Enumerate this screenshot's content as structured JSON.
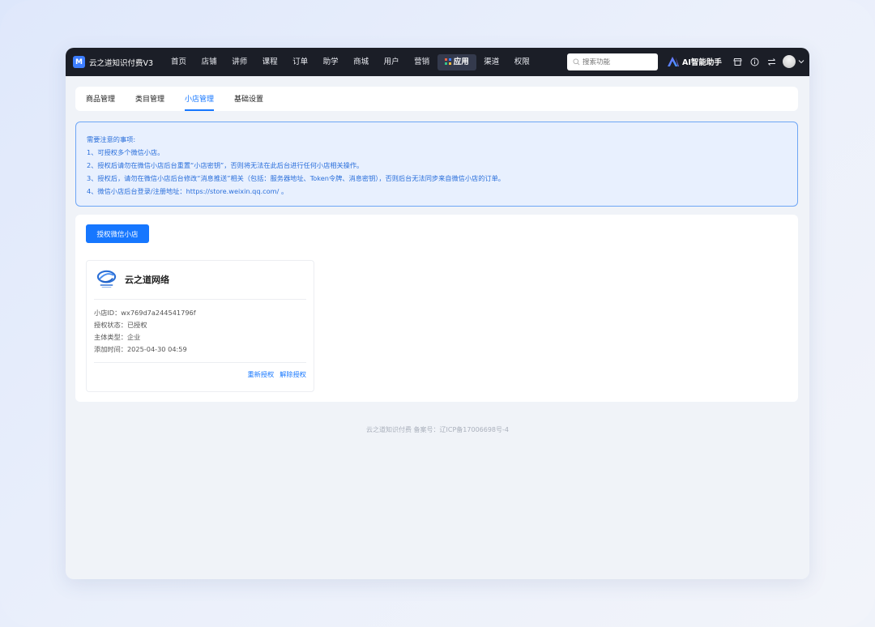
{
  "app": {
    "brand_name": "云之道知识付费V3",
    "logo_glyph": "M"
  },
  "nav": {
    "items": [
      {
        "label": "首页"
      },
      {
        "label": "店铺"
      },
      {
        "label": "讲师"
      },
      {
        "label": "课程"
      },
      {
        "label": "订单"
      },
      {
        "label": "助学"
      },
      {
        "label": "商城"
      },
      {
        "label": "用户"
      },
      {
        "label": "营销"
      },
      {
        "label": "应用",
        "active": true
      },
      {
        "label": "渠道"
      },
      {
        "label": "权限"
      }
    ],
    "search_placeholder": "搜索功能",
    "ai_label": "AI智能助手",
    "tool_icons": [
      "store-icon",
      "info-icon",
      "switch-icon"
    ]
  },
  "tabs": [
    {
      "label": "商品管理"
    },
    {
      "label": "类目管理"
    },
    {
      "label": "小店管理",
      "active": true
    },
    {
      "label": "基础设置"
    }
  ],
  "notice": {
    "title": "需要注意的事项:",
    "lines": [
      "1、可授权多个微信小店。",
      "2、授权后请勿在微信小店后台重置“小店密钥”，否则将无法在此后台进行任何小店相关操作。",
      "3、授权后，请勿在微信小店后台修改“消息推送”相关（包括：服务器地址、Token令牌、消息密钥），否则后台无法同步来自微信小店的订单。",
      "4、微信小店后台登录/注册地址：https://store.weixin.qq.com/ 。"
    ]
  },
  "main": {
    "auth_button_label": "授权微信小店",
    "shop": {
      "name": "云之道网络",
      "info": [
        "小店ID：wx769d7a244541796f",
        "授权状态：已授权",
        "主体类型：企业",
        "添加时间：2025-04-30 04:59"
      ],
      "reauth_label": "重新授权",
      "unauth_label": "解除授权"
    }
  },
  "footer": {
    "text": "云之道知识付费   备案号：辽ICP备17006698号-4"
  },
  "colors": {
    "accent": "#1677ff",
    "nav_bg": "#1b1e27",
    "notice_bg": "#e8f0fe",
    "notice_border": "#6ea6f5"
  }
}
